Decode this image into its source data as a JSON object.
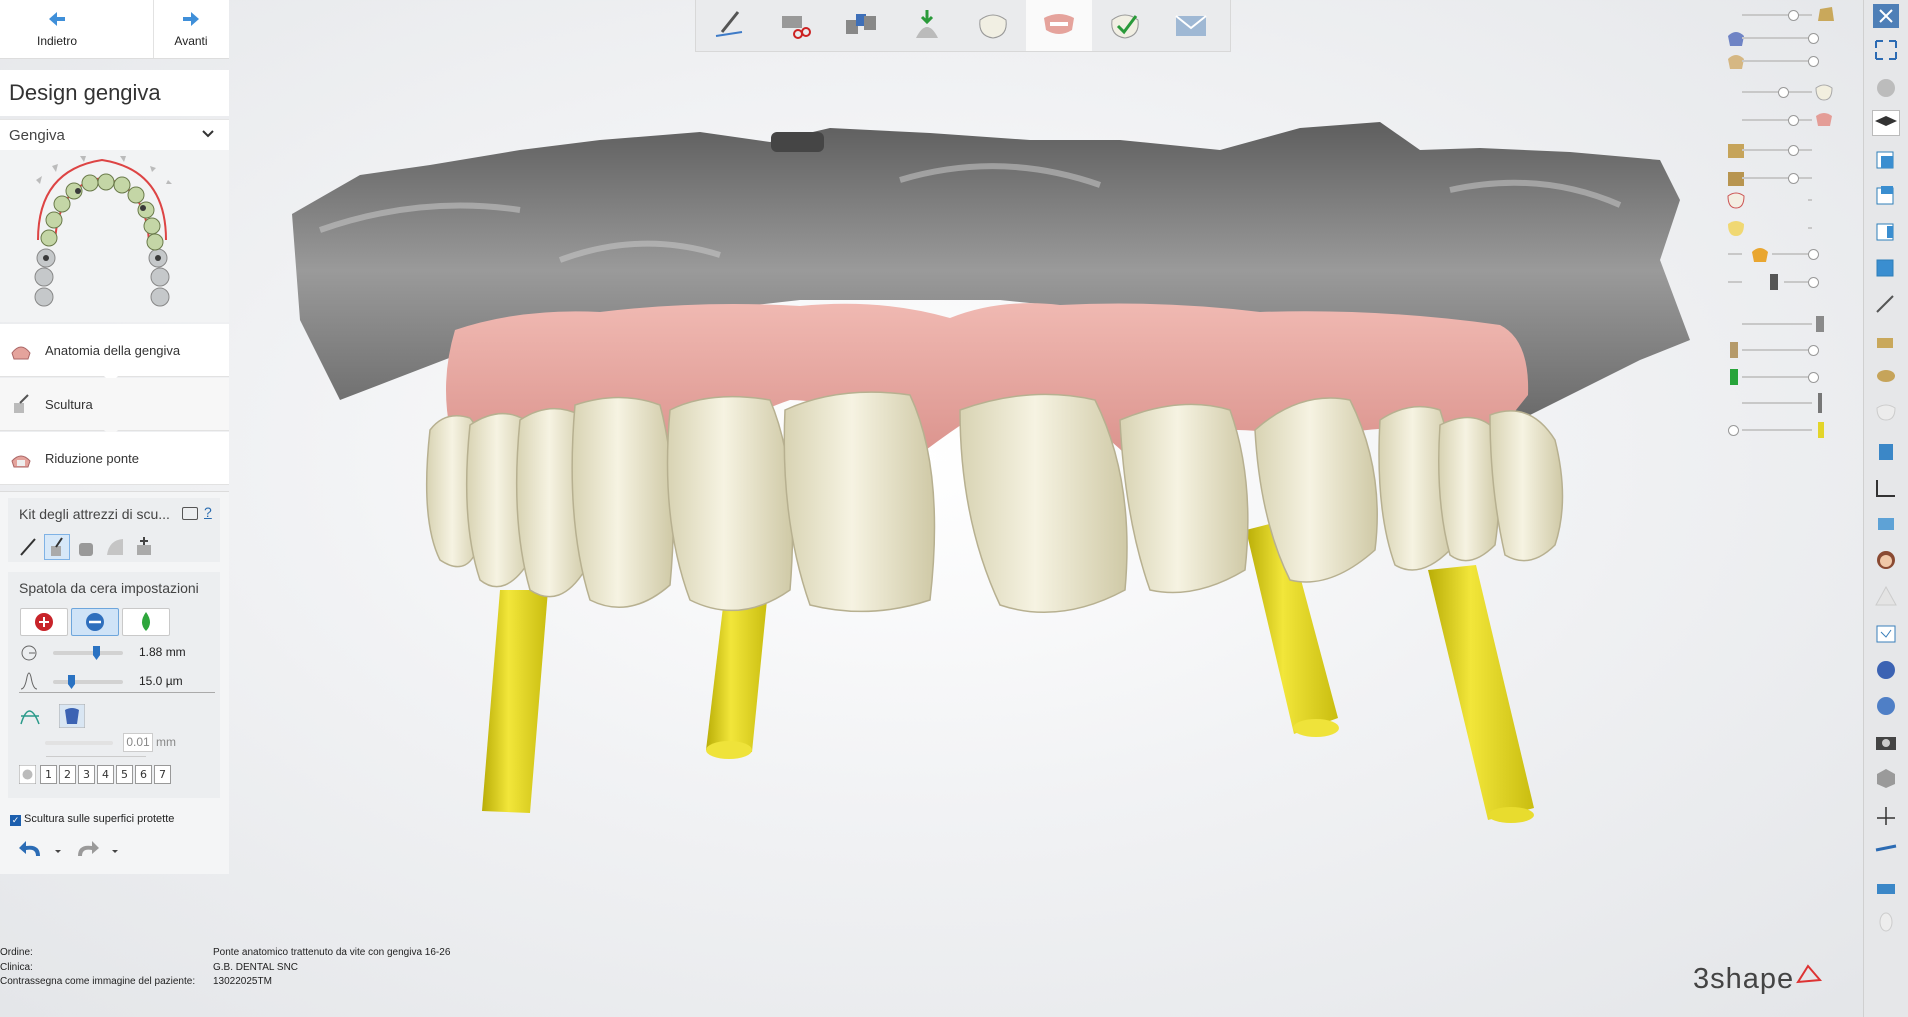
{
  "nav": {
    "back_label": "Indietro",
    "forward_label": "Avanti"
  },
  "panel": {
    "title": "Design gengiva",
    "dropdown_value": "Gengiva",
    "steps": [
      {
        "label": "Anatomia della gengiva",
        "icon": "gingiva-anatomy-icon"
      },
      {
        "label": "Scultura",
        "icon": "sculpt-icon"
      },
      {
        "label": "Riduzione ponte",
        "icon": "bridge-reduction-icon"
      }
    ]
  },
  "toolkit": {
    "title": "Kit degli attrezzi di scu...",
    "help": "?",
    "tools": [
      "knife-tool-icon",
      "wax-knife-tool-icon",
      "smooth-tool-icon",
      "morph-tool-icon",
      "transform-tool-icon"
    ]
  },
  "settings": {
    "title": "Spatola da cera impostazioni",
    "modes": [
      "add-material-icon",
      "remove-material-icon",
      "smooth-drop-icon"
    ],
    "size_value": "1.88 mm",
    "strength_value": "15.0 µm",
    "offset_value": "0.01",
    "offset_unit": "mm",
    "numbers": [
      "1",
      "2",
      "3",
      "4",
      "5",
      "6",
      "7"
    ]
  },
  "checkbox": {
    "label": "Scultura sulle superfici protette",
    "checked": true
  },
  "info": {
    "order_key": "Ordine:",
    "order_value": "Ponte anatomico trattenuto da vite con gengiva 16-26",
    "clinic_key": "Clinica:",
    "clinic_value": "G.B. DENTAL SNC",
    "patient_key": "Contrassegna come immagine del paziente:",
    "patient_value": "13022025TM"
  },
  "brand": "3shape",
  "workflow_steps": [
    "margin-icon",
    "scissors-icon",
    "links-icon",
    "insertion-icon",
    "tooth-icon",
    "gingiva-icon",
    "check-icon",
    "mail-icon"
  ],
  "colors": {
    "accent": "#2a72c2",
    "gingiva": "#e7a9a2",
    "teeth": "#eeebd3",
    "implant": "#e8dc1e",
    "model": "#7d7d7d"
  }
}
